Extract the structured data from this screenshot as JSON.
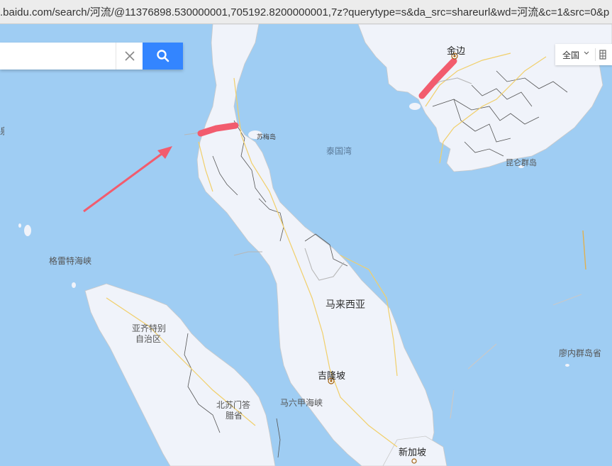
{
  "browser": {
    "url": ".baidu.com/search/河流/@11376898.530000001,705192.8200000001,7z?querytype=s&da_src=shareurl&wd=河流&c=1&src=0&p"
  },
  "search": {
    "value": "",
    "placeholder": ""
  },
  "region_select": {
    "label": "全国"
  },
  "colors": {
    "water": "#9fcdf3",
    "land": "#f0f3fa",
    "highlight": "#f25c6e",
    "search_button": "#3385ff"
  },
  "labels": {
    "jinbian": "金边",
    "sumei_island": "苏梅岛",
    "gulf_of_thailand": "泰国湾",
    "kunlun_islands": "昆仑群岛",
    "grey_strait": "格雷特海峡",
    "malaysia": "马来西亚",
    "aceh_line1": "亚齐特别",
    "aceh_line2": "自治区",
    "kuala_lumpur": "吉隆坡",
    "malacca_strait": "马六甲海峡",
    "north_sumatra_line1": "北苏门答",
    "north_sumatra_line2": "腊省",
    "singapore": "新加坡",
    "riau_islands": "廖内群岛省",
    "left_edge_fragment": "泉"
  }
}
